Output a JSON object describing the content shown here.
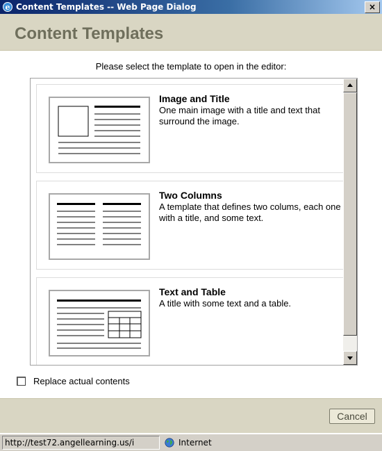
{
  "window": {
    "title": "Content Templates -- Web Page Dialog",
    "close_label": "×"
  },
  "header": {
    "title": "Content Templates"
  },
  "instruction": "Please select the template to open in the editor:",
  "templates": [
    {
      "title": "Image and Title",
      "description": "One main image with a title and text that surround the image.",
      "thumbnail": "image-and-title-thumbnail"
    },
    {
      "title": "Two Columns",
      "description": "A template that defines two colums, each one with a title, and some text.",
      "thumbnail": "two-columns-thumbnail"
    },
    {
      "title": "Text and Table",
      "description": "A title with some text and a table.",
      "thumbnail": "text-and-table-thumbnail"
    }
  ],
  "replace": {
    "label": "Replace actual contents",
    "checked": false
  },
  "footer": {
    "cancel_label": "Cancel"
  },
  "statusbar": {
    "url": "http://test72.angellearning.us/i",
    "zone": "Internet"
  },
  "icons": {
    "window": "ie-icon",
    "zone": "globe-icon"
  },
  "colors": {
    "band": "#d9d6c3",
    "header_text": "#6f6f5c",
    "titlebar": "#0a246a"
  }
}
